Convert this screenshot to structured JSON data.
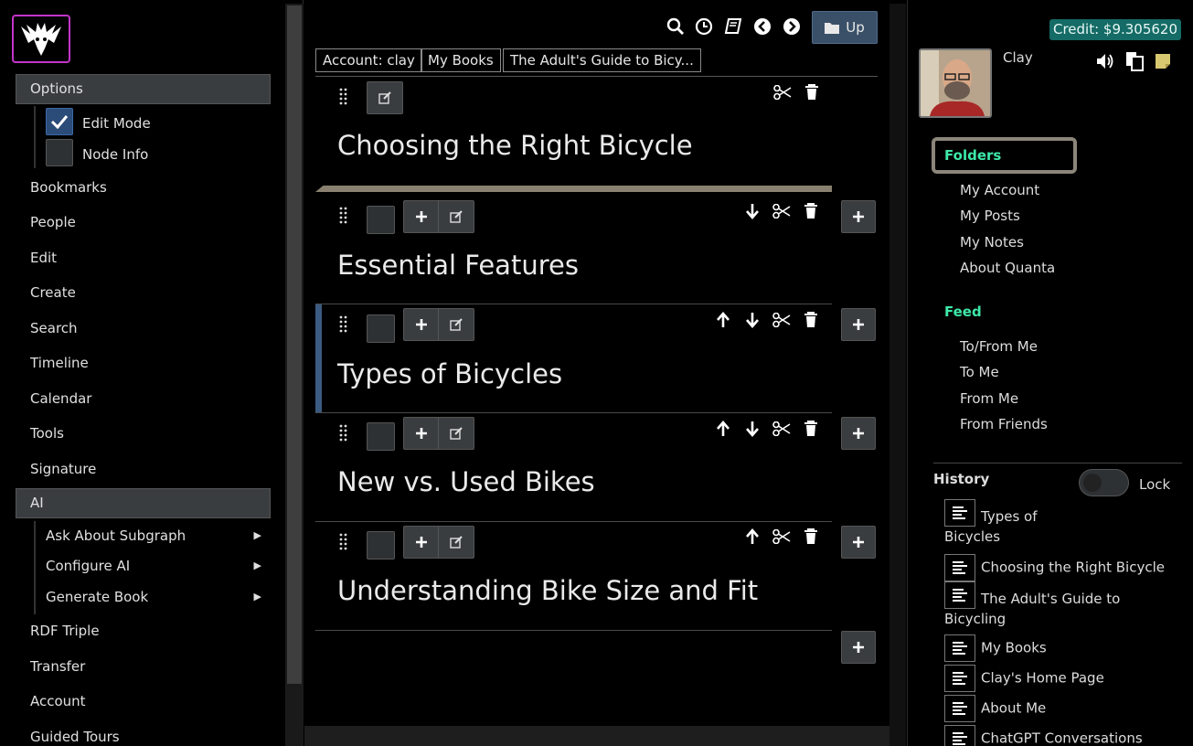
{
  "left_menu": {
    "options_label": "Options",
    "edit_mode_label": "Edit Mode",
    "edit_mode_checked": true,
    "node_info_label": "Node Info",
    "node_info_checked": false,
    "items": [
      "Bookmarks",
      "People",
      "Edit",
      "Create",
      "Search",
      "Timeline",
      "Calendar",
      "Tools",
      "Signature"
    ],
    "ai_label": "AI",
    "ai_items": [
      "Ask About Subgraph",
      "Configure AI",
      "Generate Book"
    ],
    "bottom_items": [
      "RDF Triple",
      "Transfer",
      "Account",
      "Guided Tours"
    ]
  },
  "toolbar": {
    "icons": [
      "search-icon",
      "history-icon",
      "book-icon",
      "back-icon",
      "forward-icon"
    ],
    "up_label": "Up"
  },
  "breadcrumbs": [
    "Account: clay",
    "My Books",
    "The Adult's Guide to Bicy..."
  ],
  "nodes": [
    {
      "title": "Choosing the Right Bicycle"
    },
    {
      "title": "Essential Features"
    },
    {
      "title": "Types of Bicycles"
    },
    {
      "title": "New vs. Used Bikes"
    },
    {
      "title": "Understanding Bike Size and Fit"
    }
  ],
  "right_panel": {
    "credit": "Credit: $9.305620",
    "user_name": "Clay",
    "folders_label": "Folders",
    "folder_links": [
      "My Account",
      "My Posts",
      "My Notes",
      "About Quanta"
    ],
    "feed_label": "Feed",
    "feed_links": [
      "To/From Me",
      "To Me",
      "From Me",
      "From Friends"
    ],
    "history_label": "History",
    "lock_label": "Lock",
    "history_items": [
      "Types of Bicycles",
      "Choosing the Right Bicycle",
      "The Adult's Guide to Bicycling",
      "My Books",
      "Clay's Home Page",
      "About Me",
      "ChatGPT Conversations"
    ]
  },
  "colors": {
    "accent_green": "#3ee8a8",
    "credit_bg": "#156b66",
    "logo_border": "#c335c9",
    "up_button": "#3a5068"
  }
}
